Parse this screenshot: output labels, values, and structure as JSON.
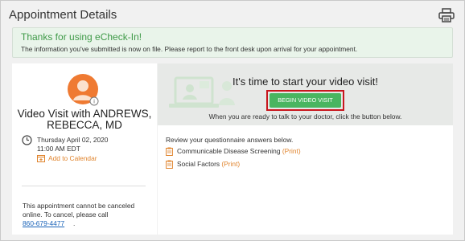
{
  "header": {
    "title": "Appointment Details",
    "print_icon": "printer-icon"
  },
  "banner": {
    "title": "Thanks for using eCheck-In!",
    "message": "The information you've submitted is now on file. Please report to the front desk upon arrival for your appointment."
  },
  "provider": {
    "avatar_icon": "provider-avatar-icon",
    "title_line1": "Video Visit with ANDREWS,",
    "title_line2": "REBECCA, MD"
  },
  "appointment": {
    "date": "Thursday April 02, 2020",
    "time": "11:00 AM EDT",
    "add_to_calendar": "Add to Calendar",
    "clock_icon": "clock-icon",
    "calendar_icon": "calendar-add-icon"
  },
  "cancel_note": {
    "line1": "This appointment cannot be canceled",
    "line2": "online. To cancel, please call",
    "phone": "860-679-4477",
    "end": "."
  },
  "video_visit": {
    "heading": "It's time to start your video visit!",
    "button_label": "BEGIN VIDEO VISIT",
    "help_text": "When you are ready to talk to your doctor, click the button below."
  },
  "questionnaires": {
    "intro": "Review your questionnaire answers below.",
    "items": [
      {
        "label": "Communicable Disease Screening",
        "print_label": "(Print)",
        "icon": "clipboard-icon"
      },
      {
        "label": "Social Factors",
        "print_label": "(Print)",
        "icon": "clipboard-icon"
      }
    ]
  },
  "colors": {
    "accent_green": "#49b560",
    "link_orange": "#e0842d",
    "highlight_red": "#c8161d",
    "avatar_orange": "#ef7a32",
    "phone_link_blue": "#1a63b8"
  }
}
